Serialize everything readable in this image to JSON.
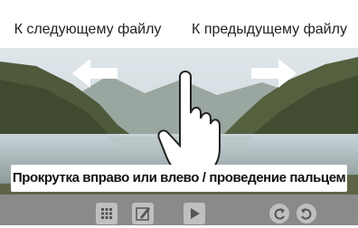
{
  "nav": {
    "next_file_label": "К следующему файлу",
    "previous_file_label": "К предыдущему файлу"
  },
  "instruction": {
    "caption": "Прокрутка вправо или влево / проведение пальцем"
  },
  "toolbar": {
    "icons": [
      "thumbnail-grid-icon",
      "edit-icon",
      "play-icon",
      "rotate-left-icon",
      "rotate-right-icon"
    ]
  },
  "colors": {
    "toolbar_bg": "#8a8a8a",
    "button_bg": "#bfbfbf",
    "arrow_fill": "#ffffff"
  }
}
